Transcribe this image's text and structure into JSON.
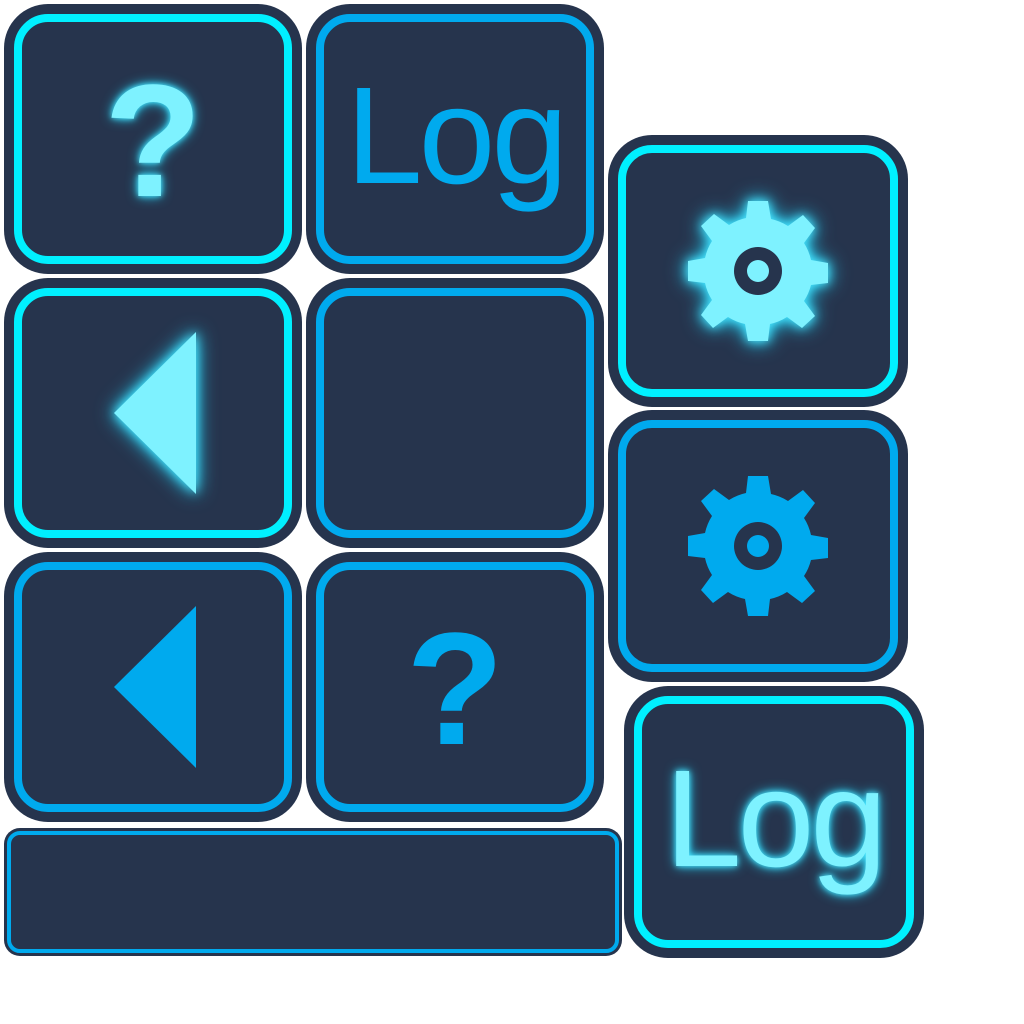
{
  "palette": {
    "button_fill": "#26344d",
    "accent": "#00aaee",
    "accent_glow": "#00f0ff",
    "glyph_glow": "#7ef2ff",
    "background": "#ffffff"
  },
  "buttons": {
    "help_hover": {
      "label": "?",
      "icon": "question-mark",
      "state": "hover"
    },
    "log_normal": {
      "label": "Log",
      "state": "normal"
    },
    "settings_hover": {
      "icon": "gear-icon",
      "state": "hover"
    },
    "back_hover": {
      "icon": "triangle-left-icon",
      "state": "hover"
    },
    "blank_normal": {
      "label": "",
      "state": "normal"
    },
    "settings_normal": {
      "icon": "gear-icon",
      "state": "normal"
    },
    "back_normal": {
      "icon": "triangle-left-icon",
      "state": "normal"
    },
    "help_normal": {
      "label": "?",
      "icon": "question-mark",
      "state": "normal"
    },
    "log_hover": {
      "label": "Log",
      "state": "hover"
    },
    "wide_bar": {
      "label": "",
      "state": "normal"
    }
  }
}
